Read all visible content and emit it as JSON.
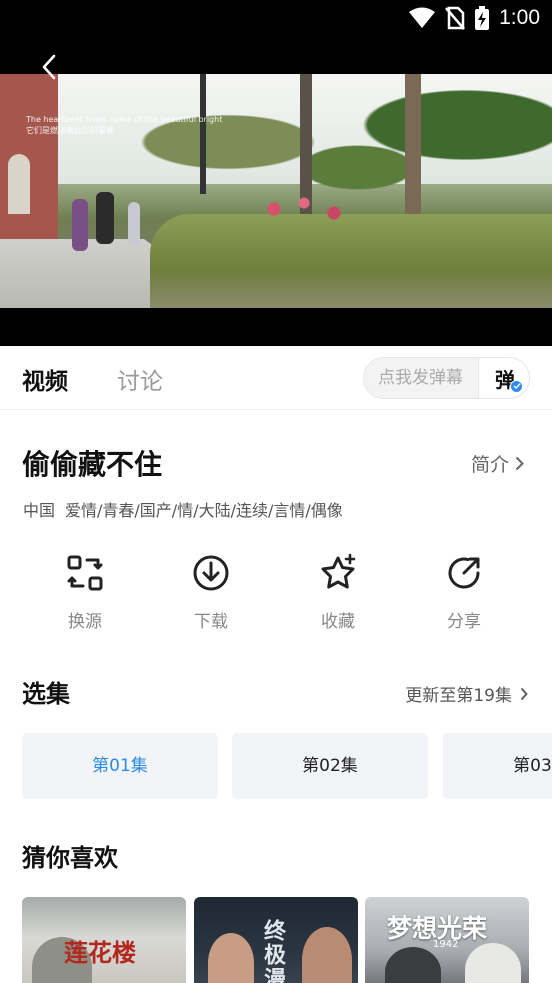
{
  "status_bar": {
    "time": "1:00",
    "icons": [
      "wifi-icon",
      "no-sim-icon",
      "battery-charging-icon"
    ]
  },
  "player": {
    "caption_line1": "The heartbeat hides name of the beautiful bright",
    "caption_line2": "它们是燃烧着灿烂的青春"
  },
  "tabs": [
    {
      "label": "视频",
      "active": true
    },
    {
      "label": "讨论",
      "active": false
    }
  ],
  "danmu": {
    "placeholder": "点我发弹幕",
    "button_label": "弹"
  },
  "show": {
    "title": "偷偷藏不住",
    "intro_label": "简介",
    "region": "中国",
    "genres": "爱情/青春/国产/情/大陆/连续/言情/偶像"
  },
  "actions": [
    {
      "label": "换源",
      "icon": "switch-source-icon"
    },
    {
      "label": "下载",
      "icon": "download-icon"
    },
    {
      "label": "收藏",
      "icon": "star-icon"
    },
    {
      "label": "分享",
      "icon": "share-icon"
    }
  ],
  "episodes": {
    "title": "选集",
    "update_label": "更新至第19集",
    "items": [
      "第01集",
      "第02集",
      "第03集"
    ],
    "active_index": 0
  },
  "recommend": {
    "title": "猜你喜欢",
    "items": [
      {
        "title": "莲花楼"
      },
      {
        "title": "终极漫"
      },
      {
        "title": "梦想光荣",
        "sub": "1942"
      }
    ]
  },
  "colors": {
    "accent": "#2d8be0",
    "background": "#ffffff",
    "chip": "#f2f4f7"
  }
}
